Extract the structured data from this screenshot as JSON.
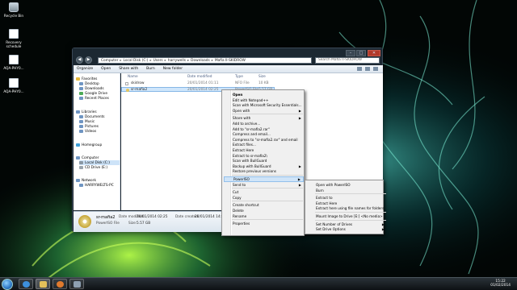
{
  "desktop": {
    "icons": [
      {
        "label": "Recycle Bin",
        "icon": "recycle-bin-icon"
      },
      {
        "label": "Recovery schedule",
        "icon": "document-icon"
      },
      {
        "label": "AQA-PHY0...",
        "icon": "document-icon"
      },
      {
        "label": "AQA-PHY0...",
        "icon": "document-icon"
      }
    ]
  },
  "window": {
    "breadcrumb": [
      "Computer",
      "Local Disk (C:)",
      "Users",
      "harrywells",
      "Downloads",
      "Mafia II-SKIDROW"
    ],
    "search_placeholder": "Search Mafia II-SKIDROW",
    "toolbar": [
      "Organize",
      "Open",
      "Share with",
      "Burn",
      "New folder"
    ],
    "nav": {
      "favorites_header": "Favorites",
      "favorites": [
        "Desktop",
        "Downloads",
        "Google Drive",
        "Recent Places"
      ],
      "libraries_header": "Libraries",
      "libraries": [
        "Documents",
        "Music",
        "Pictures",
        "Videos"
      ],
      "homegroup": "Homegroup",
      "computer_header": "Computer",
      "computer": [
        "Local Disk (C:)",
        "CD Drive (E:)"
      ],
      "network_header": "Network",
      "network": [
        "HARRYWELTS-PC"
      ]
    },
    "columns": [
      "Name",
      "Date modified",
      "Type",
      "Size"
    ],
    "files": [
      {
        "name": "skidrow",
        "date": "20/01/2014 01:11",
        "type": "NFO File",
        "size": "10 KB"
      },
      {
        "name": "sr-mafia2",
        "date": "20/01/2014 02:25",
        "type": "PowerISO File",
        "size": "5.57 GB"
      }
    ],
    "details": {
      "name": "sr-mafia2",
      "type": "PowerISO File",
      "date_modified_label": "Date modified:",
      "date_modified": "20/01/2014 02:25",
      "size_label": "Size:",
      "size": "5.57 GB",
      "date_created_label": "Date created:",
      "date_created": "28/01/2014 14:33"
    }
  },
  "context_menu": {
    "items": [
      {
        "label": "Open",
        "bold": true
      },
      {
        "label": "Edit with Notepad++"
      },
      {
        "label": "Scan with Microsoft Security Essentials..."
      },
      {
        "label": "Open with",
        "submenu": true
      },
      {
        "sep": true
      },
      {
        "label": "Share with",
        "submenu": true
      },
      {
        "label": "Add to archive..."
      },
      {
        "label": "Add to \"sr-mafia2.rar\""
      },
      {
        "label": "Compress and email..."
      },
      {
        "label": "Compress to \"sr-mafia2.rar\" and email"
      },
      {
        "label": "Extract files..."
      },
      {
        "label": "Extract Here"
      },
      {
        "label": "Extract to sr-mafia2\\"
      },
      {
        "label": "Scan with BullGuard"
      },
      {
        "label": "Backup with BullGuard",
        "submenu": true
      },
      {
        "label": "Restore previous versions"
      },
      {
        "sep": true
      },
      {
        "label": "PowerISO",
        "submenu": true,
        "highlight": true
      },
      {
        "label": "Send to",
        "submenu": true
      },
      {
        "sep": true
      },
      {
        "label": "Cut"
      },
      {
        "label": "Copy"
      },
      {
        "sep": true
      },
      {
        "label": "Create shortcut"
      },
      {
        "label": "Delete"
      },
      {
        "label": "Rename"
      },
      {
        "sep": true
      },
      {
        "label": "Properties"
      }
    ]
  },
  "submenu": {
    "items": [
      {
        "label": "Open with PowerISO"
      },
      {
        "label": "Burn"
      },
      {
        "sep": true
      },
      {
        "label": "Extract to"
      },
      {
        "label": "Extract Here"
      },
      {
        "label": "Extract here using file names for folders"
      },
      {
        "sep": true
      },
      {
        "label": "Mount Image to Drive [E:] <No media>"
      },
      {
        "sep": true
      },
      {
        "label": "Set Number of Drives",
        "submenu": true
      },
      {
        "label": "Set Drive Options",
        "submenu": true
      }
    ]
  },
  "taskbar": {
    "apps": [
      "internet-explorer-icon",
      "windows-explorer-icon",
      "media-player-icon",
      "app-icon"
    ],
    "time": "15:22",
    "date": "01/02/2014"
  },
  "colors": {
    "accent": "#3ad6a0",
    "highlight": "#cfe4f8"
  }
}
